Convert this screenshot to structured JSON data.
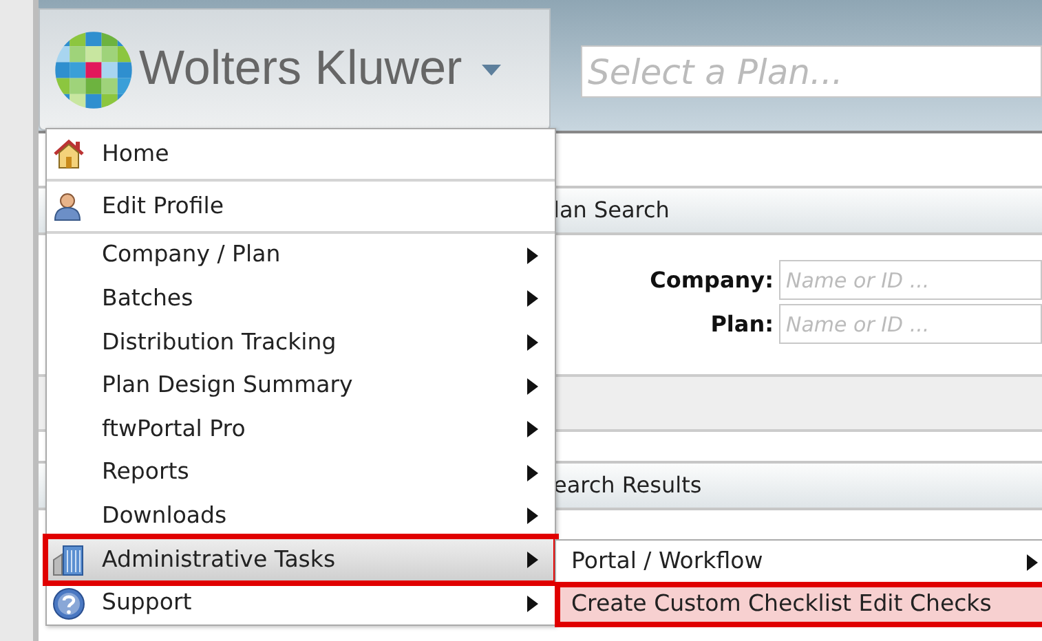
{
  "header": {
    "brand": "Wolters Kluwer",
    "plan_search": {
      "placeholder": "Select a Plan..."
    }
  },
  "page": {
    "plan_search_title": "lan Search",
    "fields": [
      {
        "label": "Company:",
        "placeholder": "Name or ID ..."
      },
      {
        "label": "Plan:",
        "placeholder": "Name or ID ..."
      }
    ],
    "results_title": "earch Results"
  },
  "menu": [
    {
      "label": "Home",
      "submenu": false,
      "selected": false,
      "annotated": false,
      "divider_below": true
    },
    {
      "label": "Edit Profile",
      "submenu": false,
      "selected": false,
      "annotated": false,
      "divider_below": true
    },
    {
      "label": "Company / Plan",
      "submenu": true,
      "selected": false,
      "annotated": false,
      "divider_below": false
    },
    {
      "label": "Batches",
      "submenu": true,
      "selected": false,
      "annotated": false,
      "divider_below": false
    },
    {
      "label": "Distribution Tracking",
      "submenu": true,
      "selected": false,
      "annotated": false,
      "divider_below": false
    },
    {
      "label": "Plan Design Summary",
      "submenu": true,
      "selected": false,
      "annotated": false,
      "divider_below": false
    },
    {
      "label": "ftwPortal Pro",
      "submenu": true,
      "selected": false,
      "annotated": false,
      "divider_below": false
    },
    {
      "label": "Reports",
      "submenu": true,
      "selected": false,
      "annotated": false,
      "divider_below": false
    },
    {
      "label": "Downloads",
      "submenu": true,
      "selected": false,
      "annotated": false,
      "divider_below": false
    },
    {
      "label": "Administrative Tasks",
      "submenu": true,
      "selected": true,
      "annotated": true,
      "divider_below": false
    },
    {
      "label": "Support",
      "submenu": true,
      "selected": false,
      "annotated": false,
      "divider_below": false
    }
  ],
  "submenu": [
    {
      "label": "Portal / Workflow",
      "submenu": true,
      "selected": false,
      "annotated": false
    },
    {
      "label": "Create Custom Checklist Edit Checks",
      "submenu": false,
      "selected": true,
      "annotated": true
    }
  ]
}
